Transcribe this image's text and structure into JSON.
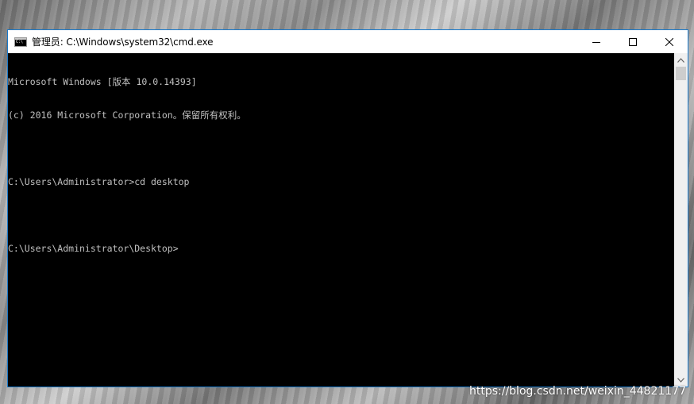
{
  "window": {
    "title": "管理员: C:\\Windows\\system32\\cmd.exe",
    "controls": {
      "minimize_icon": "minimize-icon",
      "maximize_icon": "maximize-icon",
      "close_icon": "close-icon"
    }
  },
  "console": {
    "lines": [
      "Microsoft Windows [版本 10.0.14393]",
      "(c) 2016 Microsoft Corporation。保留所有权利。",
      "",
      "C:\\Users\\Administrator>cd desktop",
      "",
      "C:\\Users\\Administrator\\Desktop>"
    ],
    "colors": {
      "background": "#000000",
      "text": "#c0c0c0"
    }
  },
  "watermark": "https://blog.csdn.net/weixin_44821177",
  "colors": {
    "window_border": "#1979ca",
    "titlebar": "#ffffff"
  }
}
